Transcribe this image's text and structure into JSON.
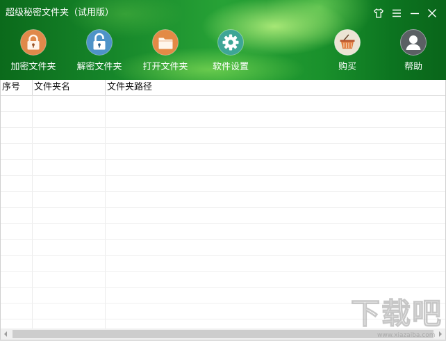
{
  "window": {
    "title": "超级秘密文件夹（试用版）",
    "controls": [
      {
        "icon": "tshirt-icon"
      },
      {
        "icon": "menu-icon"
      },
      {
        "icon": "minimize-icon"
      },
      {
        "icon": "close-icon"
      }
    ]
  },
  "theme": {
    "header_green_dark": "#0b6a1b",
    "header_green_light": "#27a236",
    "toolbar_text": "#ffffff"
  },
  "toolbar": {
    "items": [
      {
        "label": "加密文件夹",
        "icon": "lock-icon",
        "color": "#e0894a"
      },
      {
        "label": "解密文件夹",
        "icon": "unlock-icon",
        "color": "#4e93c8"
      },
      {
        "label": "打开文件夹",
        "icon": "folder-icon",
        "color": "#e38a46"
      },
      {
        "label": "软件设置",
        "icon": "gear-icon",
        "color": "#3ea696"
      },
      {
        "label": "购买",
        "icon": "shopping-basket-icon",
        "color": "#ece4d4"
      },
      {
        "label": "帮助",
        "icon": "user-icon",
        "color": "#5b6064"
      }
    ]
  },
  "table": {
    "columns": [
      "序号",
      "文件夹名",
      "文件夹路径"
    ],
    "rows": []
  },
  "watermark": {
    "text": "下载吧",
    "url": "www.xiazaiba.com"
  }
}
